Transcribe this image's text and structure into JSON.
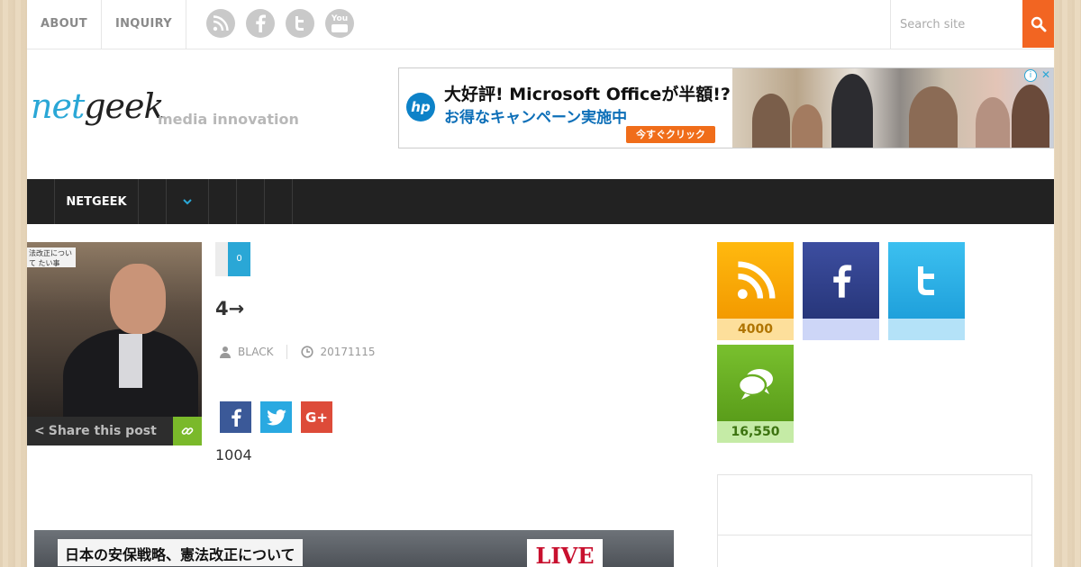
{
  "top_nav": {
    "items": [
      {
        "label": "ABOUT"
      },
      {
        "label": "INQUIRY"
      }
    ]
  },
  "social_links": [
    {
      "icon": "rss-icon"
    },
    {
      "icon": "facebook-icon"
    },
    {
      "icon": "twitter-icon"
    },
    {
      "icon": "youtube-icon",
      "text": "You"
    }
  ],
  "search": {
    "placeholder": "Search site",
    "value": "",
    "icon": "search-icon"
  },
  "header": {
    "logo": {
      "part1": "net",
      "part2": "geek"
    },
    "tagline": "media innovation"
  },
  "ad": {
    "brand": "hp",
    "headline": "大好評! Microsoft Officeが半額!?",
    "subline": "お得なキャンペーン実施中",
    "cta": "今すぐクリック",
    "info_icon": "info-icon",
    "close_icon": "close-icon",
    "close_symbol": "✕",
    "info_symbol": "i"
  },
  "main_nav": {
    "items": [
      {
        "label": "NETGEEK"
      },
      {
        "label": ""
      },
      {
        "icon": "chevron-down-icon"
      },
      {
        "label": ""
      },
      {
        "label": ""
      },
      {
        "label": ""
      }
    ]
  },
  "article": {
    "comment_count": "0",
    "title": "4→",
    "author": "BLACK",
    "date": "20171115",
    "share_label": "Share this post",
    "share_buttons": [
      {
        "icon": "facebook-icon",
        "color": "#3b5998"
      },
      {
        "icon": "twitter-icon",
        "color": "#29a9e1"
      },
      {
        "icon": "google-plus-icon",
        "color": "#dd4b39"
      }
    ],
    "body": "1004",
    "thumbnail_caption": "法改正について たい事",
    "video_caption": "日本の安保戦略、憲法改正について",
    "video_badge": "LIVE"
  },
  "sidebar": {
    "counters": [
      {
        "name": "rss",
        "icon": "rss-icon",
        "value": "4000",
        "color": "#f5a300",
        "num_bg": "#fddf9b",
        "num_color": "#b07400"
      },
      {
        "name": "facebook",
        "icon": "facebook-icon",
        "value": "",
        "color": "#2f3f87",
        "num_bg": "#cdd6f7",
        "num_color": "#2f3f87"
      },
      {
        "name": "twitter",
        "icon": "twitter-icon",
        "value": "",
        "color": "#29a9e1",
        "num_bg": "#b4e2f8",
        "num_color": "#1a7fae"
      },
      {
        "name": "comments",
        "icon": "comments-icon",
        "value": "16,550",
        "color": "#65aa21",
        "num_bg": "#c5eba6",
        "num_color": "#3c7310"
      }
    ]
  },
  "colors": {
    "accent": "#f26522",
    "nav_bg": "#222222",
    "blue": "#2aa7d6"
  }
}
